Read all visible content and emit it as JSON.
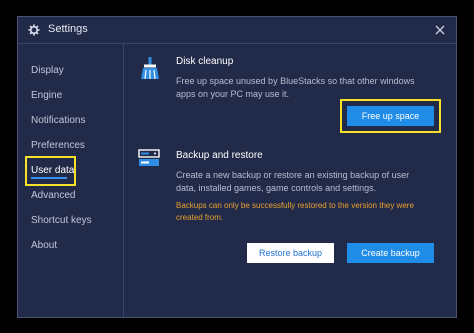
{
  "window": {
    "title": "Settings",
    "icons": {
      "title": "gear-icon",
      "close": "close-icon"
    }
  },
  "sidebar": {
    "items": [
      {
        "label": "Display",
        "active": false
      },
      {
        "label": "Engine",
        "active": false
      },
      {
        "label": "Notifications",
        "active": false
      },
      {
        "label": "Preferences",
        "active": false
      },
      {
        "label": "User data",
        "active": true
      },
      {
        "label": "Advanced",
        "active": false
      },
      {
        "label": "Shortcut keys",
        "active": false
      },
      {
        "label": "About",
        "active": false
      }
    ]
  },
  "disk_cleanup": {
    "icon": "broom-icon",
    "title": "Disk cleanup",
    "description_line1": "Free up space unused by BlueStacks so that other windows",
    "description_line2": "apps on your PC may use it.",
    "button_label": "Free up space"
  },
  "backup_restore": {
    "icon": "backup-icon",
    "title": "Backup and restore",
    "description_line1": "Create a new backup or restore an existing backup of user",
    "description_line2": "data, installed games, game controls and settings.",
    "warning_line1": "Backups can only be successfully restored to the version they were",
    "warning_line2": "created from.",
    "restore_label": "Restore backup",
    "create_label": "Create backup"
  },
  "colors": {
    "background": "#222a4a",
    "accent": "#1f8ce8",
    "highlight": "#f6e12a",
    "warning": "#e9a12e"
  }
}
